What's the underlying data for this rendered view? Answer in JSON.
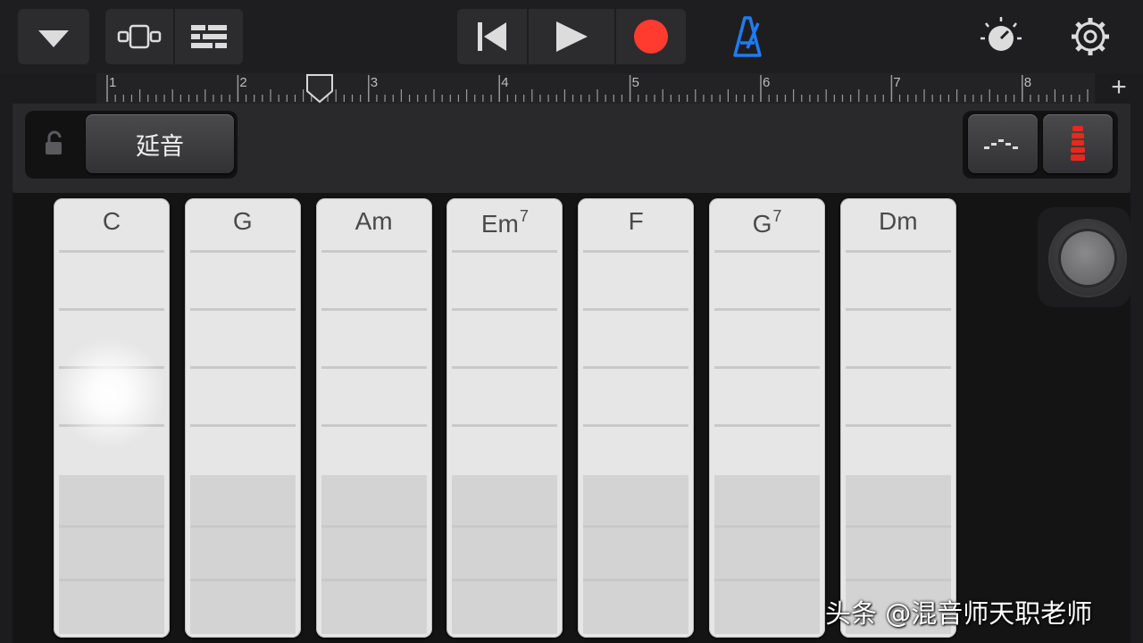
{
  "toolbar": {
    "icons": {
      "menu": "chevron-down-icon",
      "view": "view-toggle-icon",
      "tracks": "tracks-view-icon",
      "rewind": "skip-back-icon",
      "play": "play-icon",
      "record": "record-icon",
      "metronome": "metronome-icon",
      "master": "master-volume-knob-icon",
      "settings": "gear-icon"
    },
    "record_color": "#ff3b30",
    "metronome_color": "#1e7cf2"
  },
  "ruler": {
    "bars": [
      "1",
      "2",
      "3",
      "4",
      "5",
      "6",
      "7",
      "8"
    ],
    "add_label": "+"
  },
  "controls": {
    "sustain_label": "延音",
    "lock_icon": "lock-open-icon",
    "autoplay_icon": "autoplay-pattern-icon",
    "instrument_icon": "marimba-icon",
    "instrument_color": "#e8281e"
  },
  "chords": [
    {
      "root": "C",
      "sup": ""
    },
    {
      "root": "G",
      "sup": ""
    },
    {
      "root": "Am",
      "sup": ""
    },
    {
      "root": "Em",
      "sup": "7"
    },
    {
      "root": "F",
      "sup": ""
    },
    {
      "root": "G",
      "sup": "7"
    },
    {
      "root": "Dm",
      "sup": ""
    }
  ],
  "knob": {
    "icon": "tremolo-knob-icon"
  },
  "watermark": "头条 @混音师天职老师"
}
